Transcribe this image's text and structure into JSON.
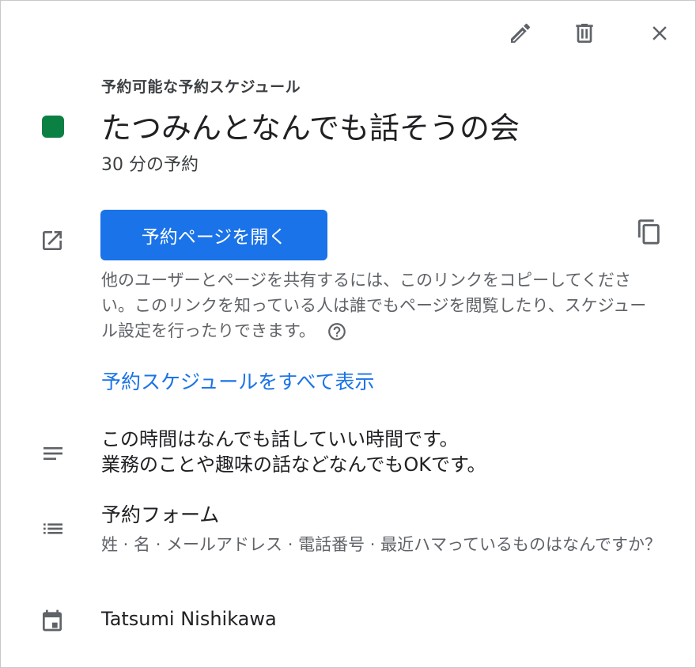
{
  "header": {
    "icons": [
      "pencil-icon",
      "trash-icon",
      "close-icon"
    ]
  },
  "schedule": {
    "eyebrow": "予約可能な予約スケジュール",
    "title": "たつみんとなんでも話そうの会",
    "duration": "30 分の予約",
    "color": "#0b8043"
  },
  "booking_page": {
    "open_button_label": "予約ページを開く",
    "share_text": "他のユーザーとページを共有するには、このリンクをコピーしてください。このリンクを知っている人は誰でもページを閲覧したり、スケジュール設定を行ったりできます。",
    "view_all_link": "予約スケジュールをすべて表示"
  },
  "description": {
    "lines": [
      "この時間はなんでも話していい時間です。",
      "業務のことや趣味の話などなんでもOKです。"
    ]
  },
  "booking_form": {
    "title": "予約フォーム",
    "fields": "姓 · 名 · メールアドレス · 電話番号 · 最近ハマっているものはなんですか？"
  },
  "calendar": {
    "owner": "Tatsumi Nishikawa"
  },
  "colors": {
    "accent": "#1a73e8",
    "icon": "#5f6368"
  }
}
